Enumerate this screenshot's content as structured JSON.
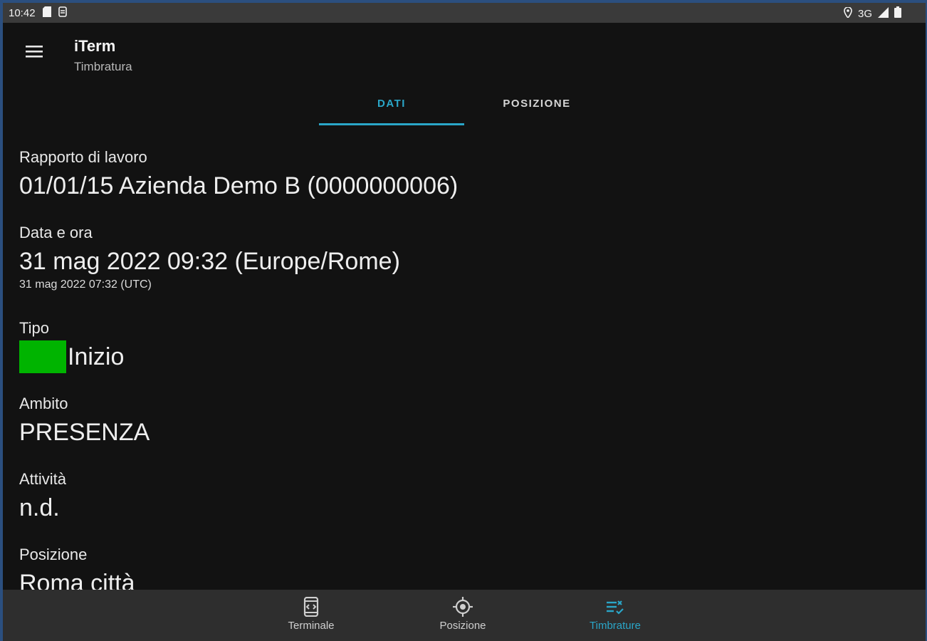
{
  "statusbar": {
    "time": "10:42",
    "network": "3G"
  },
  "appbar": {
    "title": "iTerm",
    "subtitle": "Timbratura"
  },
  "tabs": [
    {
      "label": "DATI"
    },
    {
      "label": "POSIZIONE"
    }
  ],
  "fields": {
    "rapporto": {
      "label": "Rapporto di lavoro",
      "value": "01/01/15 Azienda Demo B (0000000006)"
    },
    "data": {
      "label": "Data e ora",
      "value": "31 mag 2022 09:32 (Europe/Rome)",
      "sub": "31 mag 2022 07:32 (UTC)"
    },
    "tipo": {
      "label": "Tipo",
      "value": "Inizio",
      "color": "#00b400"
    },
    "ambito": {
      "label": "Ambito",
      "value": "PRESENZA"
    },
    "attivita": {
      "label": "Attività",
      "value": "n.d."
    },
    "posizione": {
      "label": "Posizione",
      "value": "Roma città"
    }
  },
  "bottomnav": [
    {
      "label": "Terminale",
      "icon": "terminal-icon"
    },
    {
      "label": "Posizione",
      "icon": "crosshair-icon"
    },
    {
      "label": "Timbrature",
      "icon": "timbrature-icon",
      "active": true
    }
  ],
  "colors": {
    "accent": "#2aa6c8",
    "background": "#121212",
    "tipo_inizio": "#00b400"
  }
}
